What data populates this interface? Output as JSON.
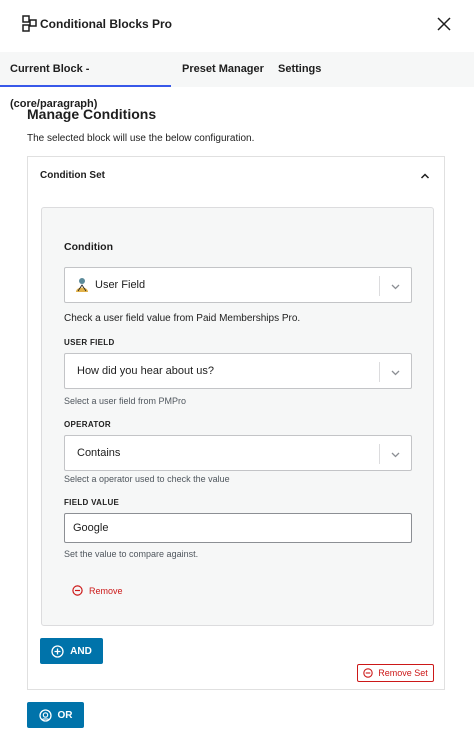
{
  "app": {
    "title": "Conditional Blocks Pro",
    "close_icon": "close-icon",
    "logo_icon": "conditional-blocks-logo-icon"
  },
  "tabs": [
    {
      "label": "Current Block - (core/paragraph)",
      "active": true
    },
    {
      "label": "Preset Manager",
      "active": false
    },
    {
      "label": "Settings",
      "active": false
    }
  ],
  "main": {
    "title": "Manage Conditions",
    "description": "The selected block will use the below configuration."
  },
  "condition_set": {
    "title": "Condition Set",
    "condition": {
      "label": "Condition",
      "selected": "User Field",
      "help": "Check a user field value from Paid Memberships Pro."
    },
    "user_field": {
      "label": "USER FIELD",
      "selected": "How did you hear about us?",
      "help": "Select a user field from PMPro"
    },
    "operator": {
      "label": "OPERATOR",
      "selected": "Contains",
      "help": "Select a operator used to check the value"
    },
    "field_value": {
      "label": "FIELD VALUE",
      "value": "Google",
      "help": "Set the value to compare against."
    },
    "remove_label": "Remove",
    "and_label": "AND",
    "remove_set_label": "Remove Set"
  },
  "or_label": "OR",
  "colors": {
    "primary": "#0073aa",
    "danger": "#cc1818",
    "tab_underline": "#3858e9"
  }
}
